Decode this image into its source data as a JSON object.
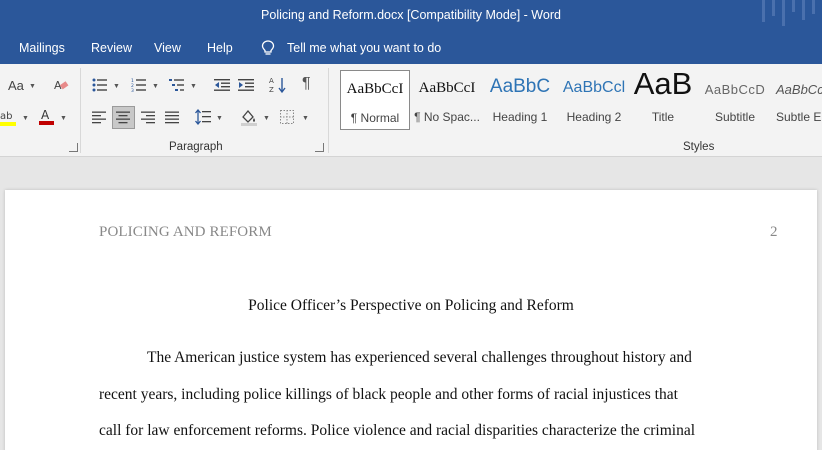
{
  "window": {
    "title": "Policing and Reform.docx [Compatibility Mode]  -  Word"
  },
  "menu": {
    "tabs": [
      "Mailings",
      "Review",
      "View",
      "Help"
    ],
    "tell_me": "Tell me what you want to do"
  },
  "ribbon": {
    "font_group": {
      "aa_label": "Aa",
      "font_color": "#c00000",
      "highlight_color": "#ffff00"
    },
    "paragraph_group": {
      "label": "Paragraph"
    },
    "styles_group": {
      "label": "Styles",
      "items": [
        {
          "preview": "AaBbCcI",
          "name": "¶ Normal",
          "selected": true
        },
        {
          "preview": "AaBbCcI",
          "name": "¶ No Spac..."
        },
        {
          "preview": "AaBbC",
          "name": "Heading 1"
        },
        {
          "preview": "AaBbCcl",
          "name": "Heading 2"
        },
        {
          "preview": "AaB",
          "name": "Title"
        },
        {
          "preview": "AaBbCcD",
          "name": "Subtitle"
        },
        {
          "preview": "AaBbCcD",
          "name": "Subtle Em"
        }
      ]
    }
  },
  "document": {
    "header": "POLICING AND REFORM",
    "page_number": "2",
    "title": "Police Officer’s Perspective on Policing and Reform",
    "lines": [
      "The American justice system has experienced several challenges throughout history and",
      "recent years, including police killings of black people and other forms of racial injustices that",
      "call for law enforcement reforms. Police violence and racial disparities characterize the criminal"
    ]
  }
}
